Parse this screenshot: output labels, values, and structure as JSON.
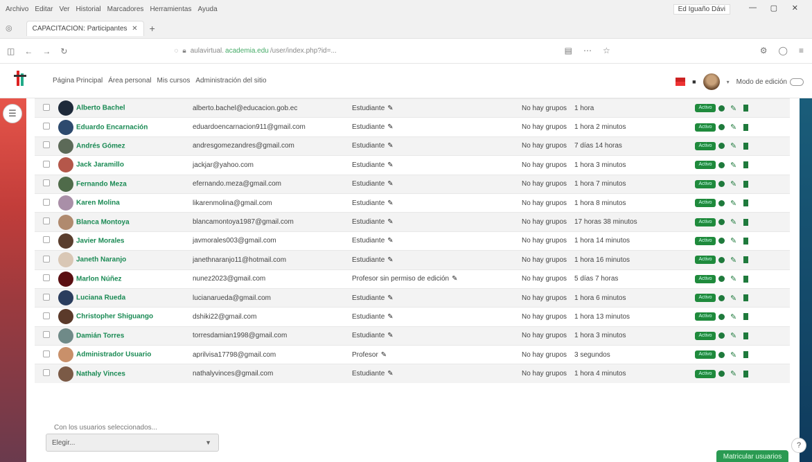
{
  "browser": {
    "menu": [
      "Archivo",
      "Editar",
      "Ver",
      "Historial",
      "Marcadores",
      "Herramientas",
      "Ayuda"
    ],
    "profile": "Ed Iguaño Dávi",
    "tab_title": "CAPACITACIÓN: Participantes",
    "url_prefix": "aulavirtual.",
    "url_host": "academia.edu",
    "url_suffix": "/user/index.php?id=..."
  },
  "site": {
    "nav": [
      "Página Principal",
      "Área personal",
      "Mis cursos",
      "Administración del sitio"
    ],
    "edit_mode": "Modo de edición"
  },
  "users": [
    {
      "name": "Alberto Bachel",
      "email": "alberto.bachel@educacion.gob.ec",
      "role": "Estudiante",
      "groups": "No hay grupos",
      "access": "1 hora",
      "avatar": "#1e2a3a"
    },
    {
      "name": "Eduardo Encarnación",
      "email": "eduardoencarnacion911@gmail.com",
      "role": "Estudiante",
      "groups": "No hay grupos",
      "access": "1 hora 2 minutos",
      "avatar": "#2d4a6e"
    },
    {
      "name": "Andrés Gómez",
      "email": "andresgomezandres@gmail.com",
      "role": "Estudiante",
      "groups": "No hay grupos",
      "access": "7 días 14 horas",
      "avatar": "#5c6a58"
    },
    {
      "name": "Jack Jaramillo",
      "email": "jackjar@yahoo.com",
      "role": "Estudiante",
      "groups": "No hay grupos",
      "access": "1 hora 3 minutos",
      "avatar": "#b5574a"
    },
    {
      "name": "Fernando Meza",
      "email": "efernando.meza@gmail.com",
      "role": "Estudiante",
      "groups": "No hay grupos",
      "access": "1 hora 7 minutos",
      "avatar": "#4f6b4a"
    },
    {
      "name": "Karen Molina",
      "email": "likarenmolina@gmail.com",
      "role": "Estudiante",
      "groups": "No hay grupos",
      "access": "1 hora 8 minutos",
      "avatar": "#a98fa8"
    },
    {
      "name": "Blanca Montoya",
      "email": "blancamontoya1987@gmail.com",
      "role": "Estudiante",
      "groups": "No hay grupos",
      "access": "17 horas 38 minutos",
      "avatar": "#b08a6e"
    },
    {
      "name": "Javier Morales",
      "email": "javmorales003@gmail.com",
      "role": "Estudiante",
      "groups": "No hay grupos",
      "access": "1 hora 14 minutos",
      "avatar": "#5a3e2e"
    },
    {
      "name": "Janeth Naranjo",
      "email": "janethnaranjo11@hotmail.com",
      "role": "Estudiante",
      "groups": "No hay grupos",
      "access": "1 hora 16 minutos",
      "avatar": "#d9c7b5"
    },
    {
      "name": "Marlon Núñez",
      "email": "nunez2023@gmail.com",
      "role": "Profesor sin permiso de edición",
      "groups": "No hay grupos",
      "access": "5 días 7 horas",
      "avatar": "#5a0f12"
    },
    {
      "name": "Luciana Rueda",
      "email": "lucianarueda@gmail.com",
      "role": "Estudiante",
      "groups": "No hay grupos",
      "access": "1 hora 6 minutos",
      "avatar": "#2a3d5e"
    },
    {
      "name": "Christopher Shiguango",
      "email": "dshiki22@gmail.com",
      "role": "Estudiante",
      "groups": "No hay grupos",
      "access": "1 hora 13 minutos",
      "avatar": "#5b3a2a"
    },
    {
      "name": "Damián Torres",
      "email": "torresdamian1998@gmail.com",
      "role": "Estudiante",
      "groups": "No hay grupos",
      "access": "1 hora 3 minutos",
      "avatar": "#6f8a88"
    },
    {
      "name": "Administrador Usuario",
      "email": "aprilvisa17798@gmail.com",
      "role": "Profesor",
      "groups": "No hay grupos",
      "access": "3 segundos",
      "avatar": "#c9906a"
    },
    {
      "name": "Nathaly Vinces",
      "email": "nathalyvinces@gmail.com",
      "role": "Estudiante",
      "groups": "No hay grupos",
      "access": "1 hora 4 minutos",
      "avatar": "#7b5a46"
    }
  ],
  "status_label": "Activo",
  "bulk": {
    "label": "Con los usuarios seleccionados...",
    "select_value": "Elegir..."
  },
  "enrol_button": "Matricular usuarios"
}
